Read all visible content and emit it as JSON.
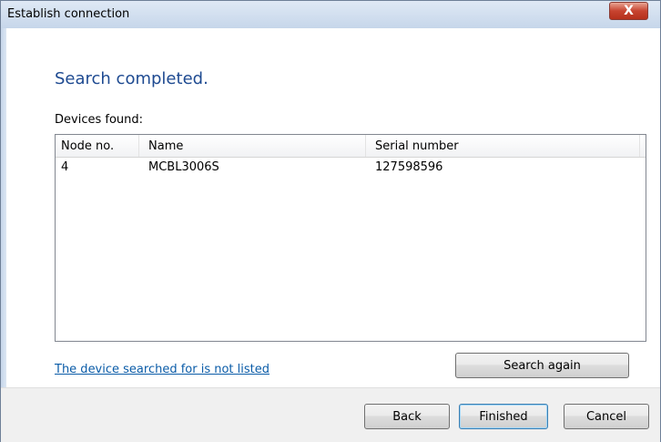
{
  "window": {
    "title": "Establish connection",
    "close_icon": "close-icon",
    "close_glyph": "X"
  },
  "main": {
    "heading": "Search completed.",
    "devices_label": "Devices found:",
    "table": {
      "columns": [
        "Node no.",
        "Name",
        "Serial number"
      ],
      "rows": [
        [
          "4",
          "MCBL3006S",
          "127598596"
        ]
      ]
    },
    "not_listed_link": "The device searched for is not listed",
    "search_again_label": "Search again"
  },
  "footer": {
    "back_label": "Back",
    "finished_label": "Finished",
    "cancel_label": "Cancel"
  },
  "colors": {
    "heading": "#1e4a91",
    "link": "#0b5ca8",
    "close_button": "#c7432f"
  }
}
